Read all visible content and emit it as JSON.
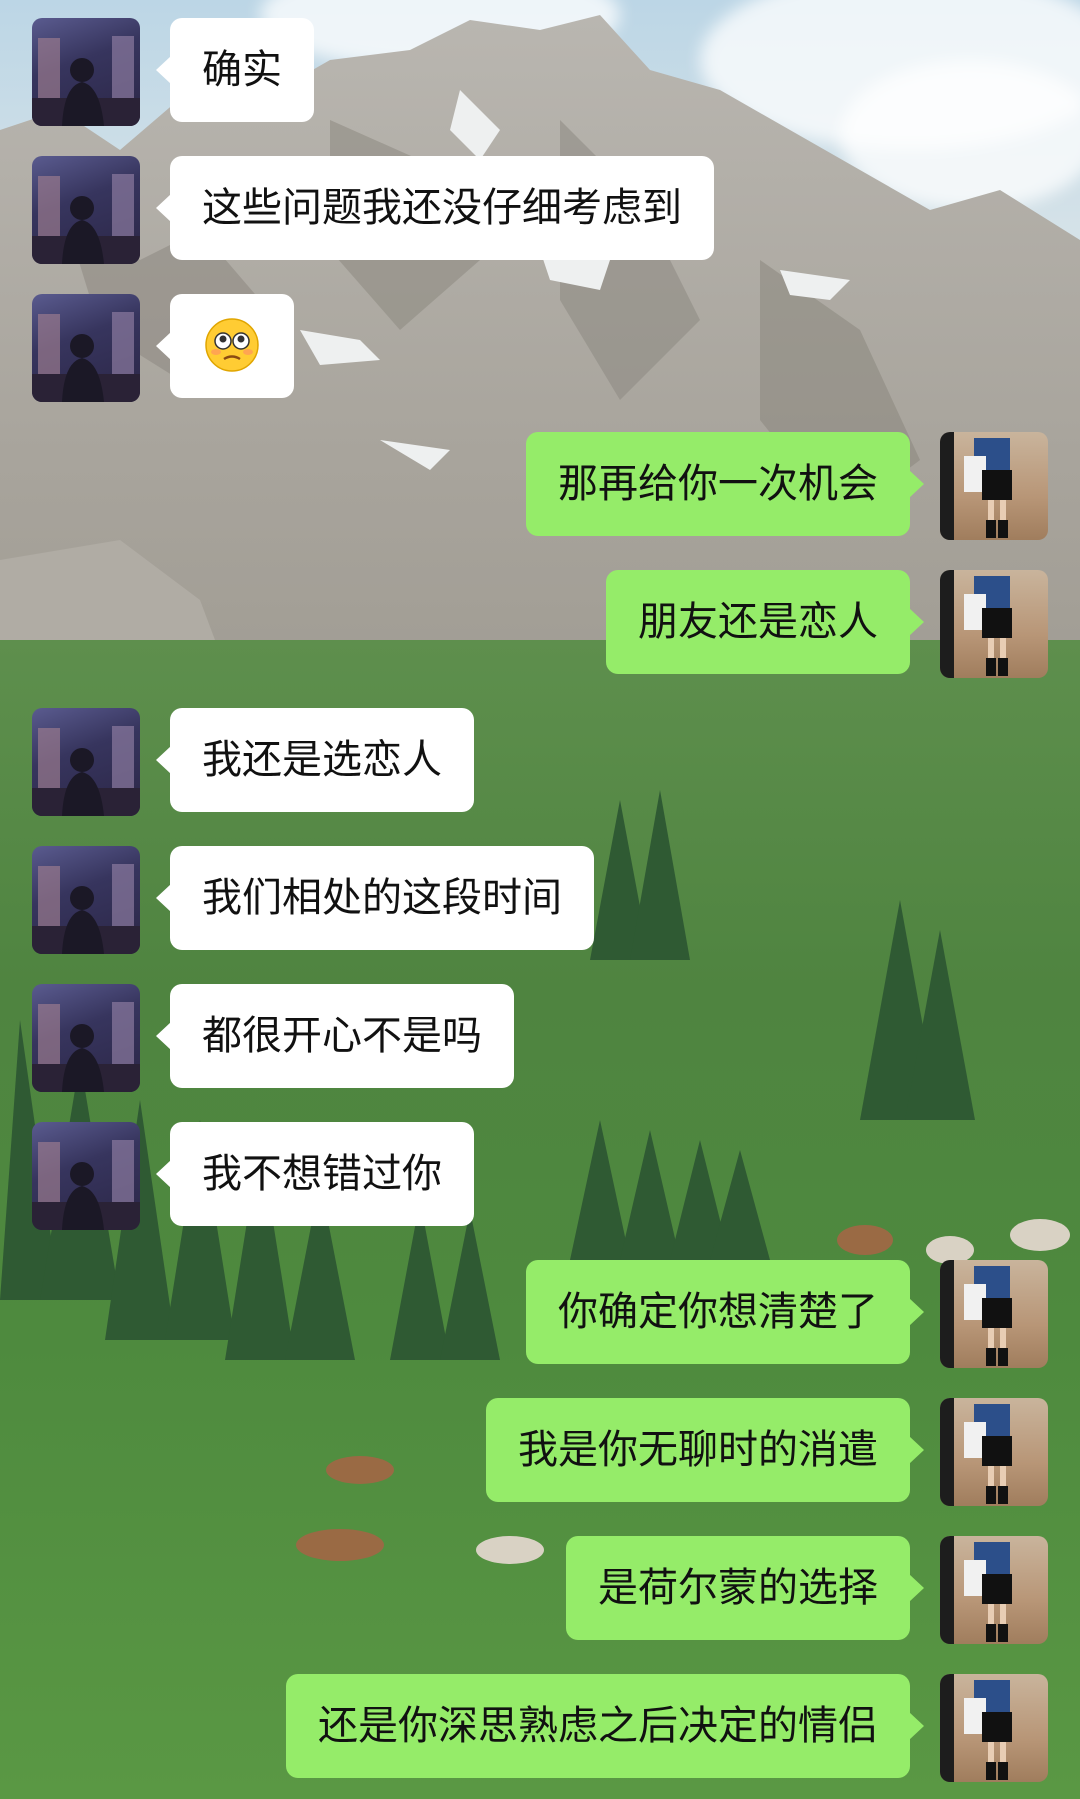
{
  "colors": {
    "sent_bubble": "#95ec69",
    "received_bubble": "#ffffff",
    "text": "#111111"
  },
  "messages": [
    {
      "side": "left",
      "text": "确实"
    },
    {
      "side": "left",
      "text": "这些问题我还没仔细考虑到"
    },
    {
      "side": "left",
      "text": "",
      "emoji": "flushed-face-emoji"
    },
    {
      "side": "right",
      "text": "那再给你一次机会"
    },
    {
      "side": "right",
      "text": "朋友还是恋人"
    },
    {
      "side": "left",
      "text": "我还是选恋人"
    },
    {
      "side": "left",
      "text": "我们相处的这段时间"
    },
    {
      "side": "left",
      "text": "都很开心不是吗"
    },
    {
      "side": "left",
      "text": "我不想错过你"
    },
    {
      "side": "right",
      "text": "你确定你想清楚了"
    },
    {
      "side": "right",
      "text": "我是你无聊时的消遣"
    },
    {
      "side": "right",
      "text": "是荷尔蒙的选择"
    },
    {
      "side": "right",
      "text": "还是你深思熟虑之后决定的情侣"
    }
  ]
}
